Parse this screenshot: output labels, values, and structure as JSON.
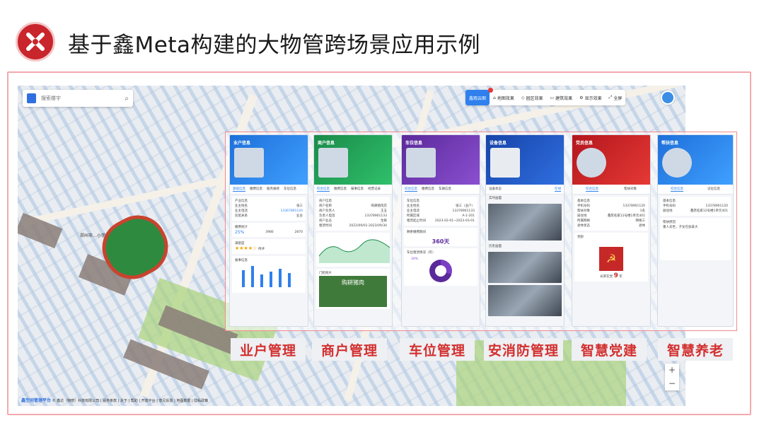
{
  "header": {
    "title": "基于鑫Meta构建的大物管跨场景应用示例"
  },
  "search": {
    "placeholder": "搜索楼宇"
  },
  "toolbar": {
    "items": [
      "鑫观云图",
      "地图效果",
      "园区效果",
      "建筑效果",
      "显示效果",
      "全屏"
    ]
  },
  "map": {
    "school_label": "郑州市…小学"
  },
  "footer": {
    "brand": "鑫空间管理平台",
    "text": "© 鑫达（物管）科技有限公司 | 服务条款 | 关于 | 帮助 | 开放平台 | 意见反馈 | 地图数据 | 隐私政策"
  },
  "zoom": {
    "in": "+",
    "out": "−"
  },
  "panels": [
    {
      "title": "业户信息",
      "color": "#1e6fd9",
      "tabs": [
        "基础信息",
        "缴费信息",
        "服务报修",
        "车位信息"
      ],
      "s1": "产业信息",
      "rows": [
        [
          "业主姓名",
          "张三"
        ],
        [
          "业主电话",
          "13367891120"
        ],
        [
          "房屋关系",
          "业主"
        ]
      ],
      "s2": "缴费统计",
      "pct": "25%",
      "n1": "3980",
      "n2": "2870",
      "s3": "满意度",
      "sat": "待评",
      "s4": "报事信息"
    },
    {
      "title": "商户信息",
      "color": "#1a8a4a",
      "tabs": [
        "综合信息",
        "缴费信息",
        "报事信息",
        "经营记录"
      ],
      "s1": "商户信息",
      "rows": [
        [
          "商户名称",
          "购耕猪肉店"
        ],
        [
          "商户负责人",
          "王五"
        ],
        [
          "负责人电话",
          "13378901133"
        ],
        [
          "商户业态",
          "生鲜"
        ],
        [
          "租赁时间",
          "2022/09/01-2023/09/30"
        ]
      ],
      "s2": "门脸照片",
      "shop": "购耕猪肉"
    },
    {
      "title": "车位信息",
      "color": "#5b2a9a",
      "tabs": [
        "综合信息",
        "缴费信息",
        "车辆信息"
      ],
      "s1": "车位信息",
      "rows": [
        [
          "业主姓名",
          "张三（业户）"
        ],
        [
          "业主电话",
          "13378901133"
        ],
        [
          "所属区域",
          "A-1-201"
        ],
        [
          "租赁起止时间",
          "2023-02-01~2023-03-01"
        ]
      ],
      "s2": "剩余缴费期间",
      "days": "360天",
      "s3": "车位租赁情况（年）",
      "pct": "30%"
    },
    {
      "title": "设备信息",
      "color": "#1743a8",
      "tabs": [
        "设备状态",
        "在线"
      ],
      "s1": "实时画面",
      "s2": "历史画面"
    },
    {
      "title": "党员信息",
      "color": "#b3161d",
      "tabs": [
        "综合信息",
        "帮扶对象"
      ],
      "s1": "基本信息",
      "rows": [
        [
          "手机号码",
          "13378901120"
        ],
        [
          "帮扶对象",
          "1名"
        ],
        [
          "居住地",
          "鑫苑名家12号楼1单元401"
        ],
        [
          "所属网格",
          "网格三"
        ],
        [
          "退休状态",
          "退休"
        ]
      ],
      "s2": "党龄",
      "years_prefix": "光荣在党",
      "years": "9",
      "years_suffix": "年"
    },
    {
      "title": "帮扶信息",
      "color": "#1e6fd9",
      "tabs": [
        "综合信息",
        "记位信息"
      ],
      "s1": "基本信息",
      "rows": [
        [
          "手机号码",
          "13378901120"
        ],
        [
          "居住地",
          "鑫苑名家12号楼1单元401"
        ]
      ],
      "s2": "帮扶原因",
      "reason": "重人去世，子女在加拿大"
    }
  ],
  "labels": [
    "业户管理",
    "商户管理",
    "车位管理",
    "安消防管理",
    "智慧党建",
    "智慧养老"
  ]
}
